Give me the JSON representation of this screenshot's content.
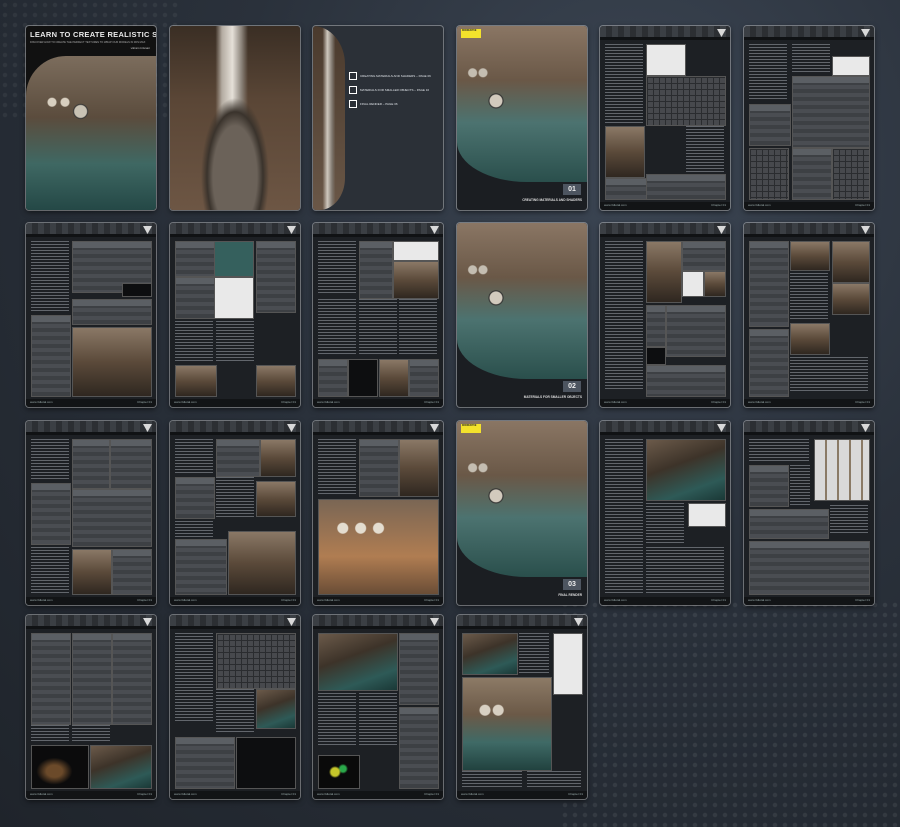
{
  "cover": {
    "title": "LEARN TO CREATE REALISTIC SHADERS",
    "subtitle": "DISCOVER HOW TO CREATE THE PERFECT TEXTURES TO WRAP OUR MODELS IN 3DS MAX",
    "author": "vikram krisnan"
  },
  "contents": {
    "items": [
      "CREATING MATERIALS AND SHADERS – PAGE 06",
      "MATERIALS FOR SMALLER OBJECTS – PAGE 16",
      "FINAL RENDER – PAGE 36"
    ]
  },
  "chapters": [
    {
      "badge": "3DCREATIVE",
      "number": "01",
      "title": "CREATING MATERIALS AND SHADERS"
    },
    {
      "badge": "3DCREATIVE",
      "number": "02",
      "title": "MATERIALS FOR SMALLER OBJECTS"
    },
    {
      "badge": "3DCREATIVE",
      "number": "03",
      "title": "FINAL RENDER"
    }
  ],
  "footer": {
    "site": "www.3dtotal.com",
    "chapter_label": "Chapter 01"
  }
}
